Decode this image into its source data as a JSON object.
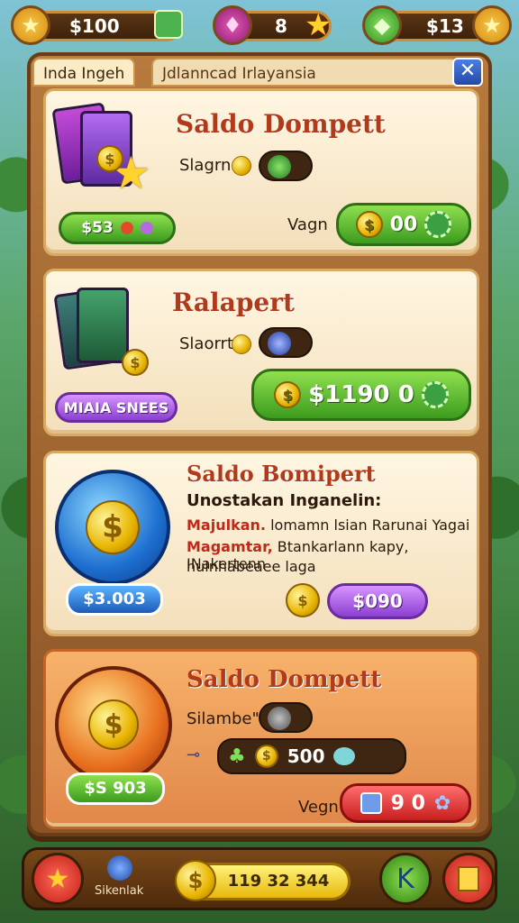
{
  "topbar": {
    "money_left": "$100",
    "gems": "8",
    "money_right": "$13"
  },
  "tabs": {
    "active": "Inda Ingeh",
    "inactive": "Jdlanncad Irlayansia",
    "close": "✕"
  },
  "cards": [
    {
      "title": "Saldo Dompett",
      "slot_label": "Slagrn",
      "price_badge": "$53",
      "action_label": "Vagn",
      "action_value": "00"
    },
    {
      "title": "Ralapert",
      "slot_label": "Slaorrt",
      "badge": "MIAIA SNEES",
      "action_value": "$1190 0"
    },
    {
      "title": "Saldo Bomipert",
      "subtitle": "Unostakan Inganelin:",
      "line1_bold": "Majulkan.",
      "line1_rest": "lomamn lsian Rarunai Yagai",
      "line2_bold": "Magamtar,",
      "line2_rest": "Btankarlann kapy, INakertenn",
      "line3": "hulnhabeaee laga",
      "orb_value": "$3.003",
      "button_value": "$090"
    },
    {
      "title": "Saldo Dompett",
      "slot_label": "Silambe\"t",
      "bar_value": "500",
      "orb_value": "$S 903",
      "action_label": "Vegn",
      "action_value": "9 0"
    }
  ],
  "bottombar": {
    "small_label": "Sikenlak",
    "coins": "119 32 344"
  },
  "colors": {
    "accent_red": "#b13a1b",
    "green_button": "#3c9b1e",
    "purple_button": "#8b3fd0"
  }
}
